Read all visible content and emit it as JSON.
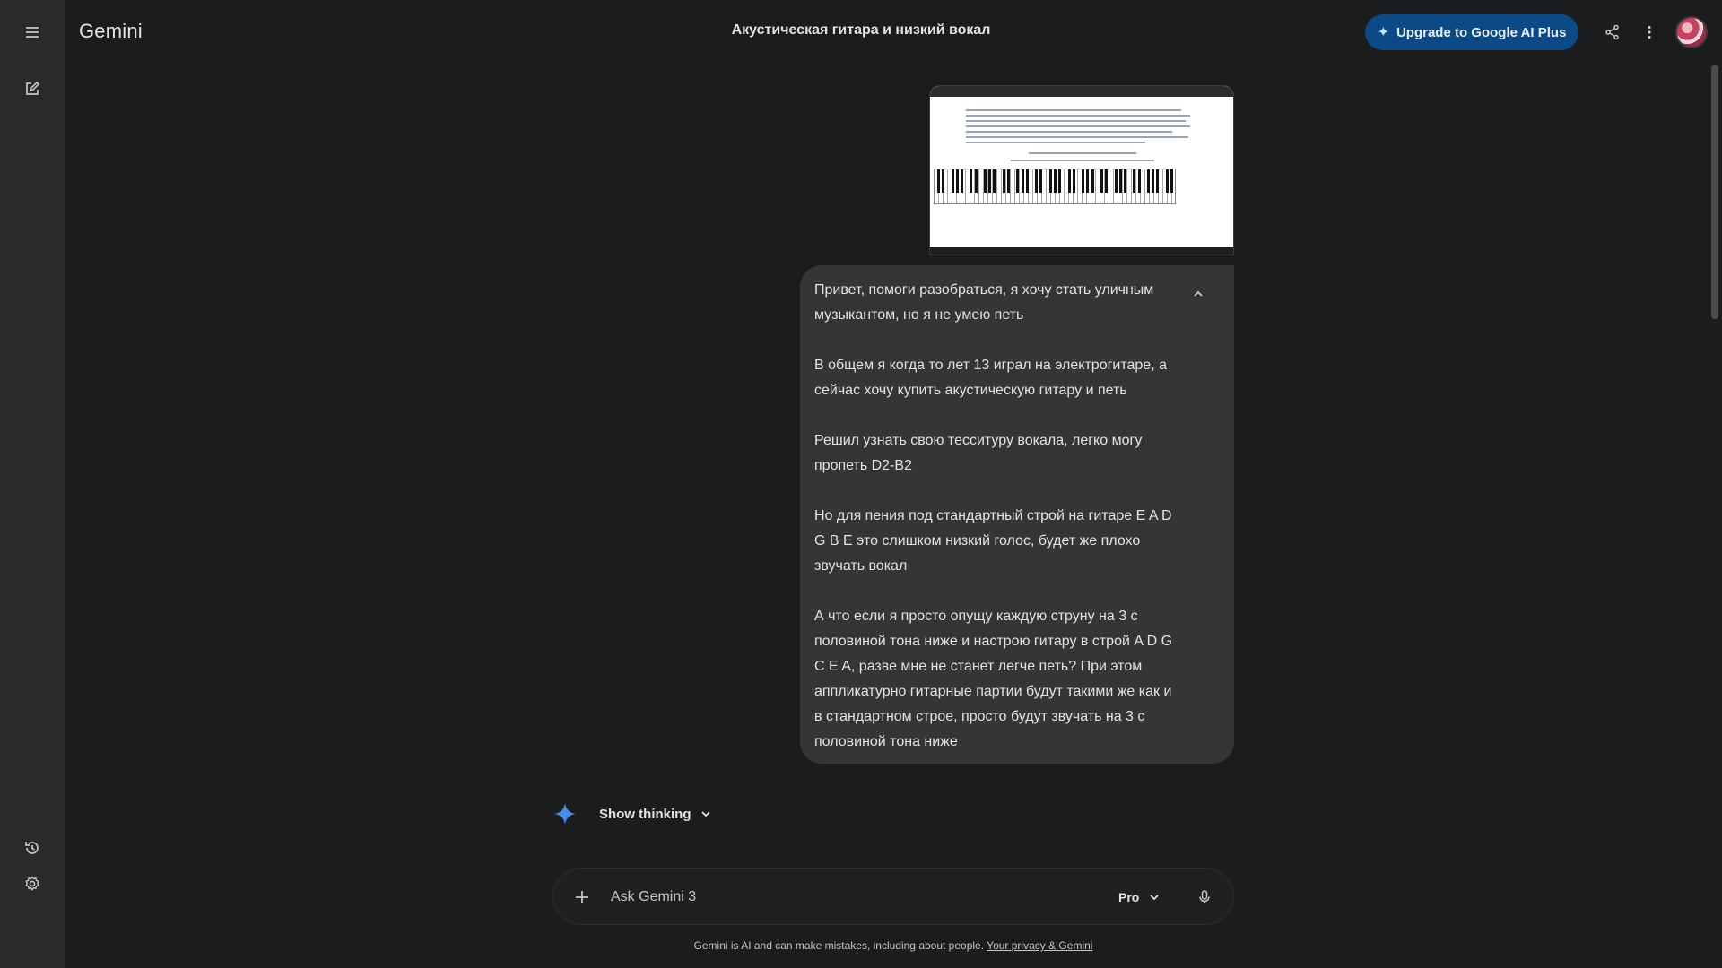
{
  "app": {
    "brand": "Gemini"
  },
  "header": {
    "title": "Акустическая гитара и низкий вокал",
    "upgrade_label": "Upgrade to Google AI Plus"
  },
  "sidebar": {
    "icons": [
      "menu-icon",
      "new-chat-icon",
      "activity-icon",
      "settings-icon"
    ]
  },
  "conversation": {
    "user_message": {
      "paragraphs": [
        "Привет, помоги разобраться, я хочу стать уличным музыкантом, но я не умею петь",
        "В общем я когда то лет 13 играл на электрогитаре, а сейчас хочу купить акустическую гитару и петь",
        "Решил узнать свою тесситуру вокала, легко могу пропеть D2-B2",
        "Но для пения под стандартный строй на гитаре E A D G B E это слишком низкий голос, будет же плохо звучать вокал",
        "А что если я просто опущу каждую струну на 3 с половиной тона ниже и настрою гитару в строй A D G C E A, разве мне не станет легче петь? При этом аппликатурно гитарные партии будут такими же как и в стандартном строе, просто будут звучать на 3 с половиной тона ниже"
      ]
    },
    "thinking_label": "Show thinking"
  },
  "composer": {
    "placeholder": "Ask Gemini 3",
    "model": "Pro"
  },
  "footer": {
    "disclaimer": "Gemini is AI and can make mistakes, including about people.",
    "privacy_link": "Your privacy & Gemini"
  },
  "colors": {
    "background": "#1b1c1d",
    "sidebar": "#282a2c",
    "bubble": "#333537",
    "upgrade_button": "#0b4a86",
    "accent_spark": "#4285f4"
  }
}
